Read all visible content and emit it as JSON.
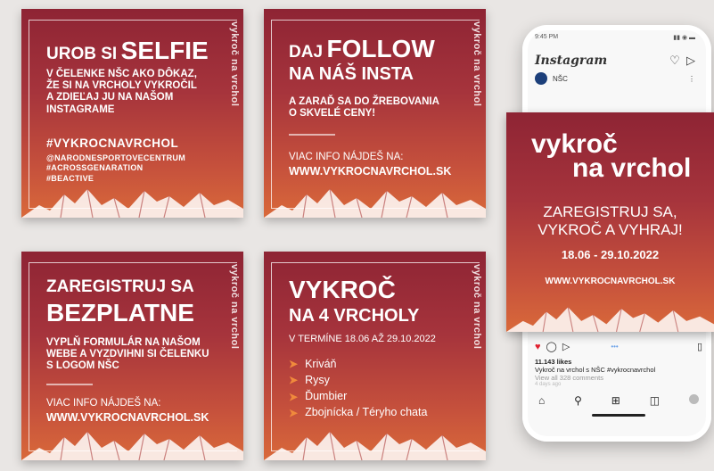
{
  "card1": {
    "logo": "vykroč na vrchol",
    "title_a": "UROB SI",
    "title_b": "SELFIE",
    "body": [
      "V ČELENKE NŠC AKO DÔKAZ,",
      "ŽE SI NA VRCHOLY VYKROČIL",
      "A ZDIEĽAJ JU NA NAŠOM",
      "INSTAGRAME"
    ],
    "hashtag": "#VYKROCNAVRCHOL",
    "tags": [
      "@NARODNESPORTOVECENTRUM",
      "#ACROSSGENARATION",
      "#BEACTIVE"
    ]
  },
  "card2": {
    "logo": "vykroč na vrchol",
    "title_a": "DAJ",
    "title_b": "FOLLOW",
    "title_c": "NA NÁŠ INSTA",
    "body": [
      "A ZARAĎ SA DO ŽREBOVANIA",
      "O SKVELÉ CENY!"
    ],
    "info": "VIAC INFO NÁJDEŠ NA:",
    "url": "WWW.VYKROCNAVRCHOL.SK"
  },
  "card3": {
    "logo": "vykroč na vrchol",
    "title_a": "ZAREGISTRUJ SA",
    "title_b": "BEZPLATNE",
    "body": [
      "VYPLŇ FORMULÁR NA NAŠOM",
      "WEBE A VYZDVIHNI SI ČELENKU",
      "S LOGOM NŠC"
    ],
    "info": "VIAC INFO NÁJDEŠ NA:",
    "url": "WWW.VYKROCNAVRCHOL.SK"
  },
  "card4": {
    "logo": "vykroč na vrchol",
    "title_a": "VYKROČ",
    "title_b": "NA 4 VRCHOLY",
    "dates": "V TERMÍNE 18.06 AŽ 29.10.2022",
    "peaks": [
      "Kriváň",
      "Rysy",
      "Ďumbier",
      "Zbojnícka / Téryho chata"
    ]
  },
  "phone": {
    "time": "9:45 PM",
    "app": "Instagram",
    "account": "NŠC",
    "post": {
      "logo_a": "vykroč",
      "logo_b": "na vrchol",
      "line1": "ZAREGISTRUJ SA,",
      "line2": "VYKROČ A VYHRAJ!",
      "dates": "18.06 - 29.10.2022",
      "url": "WWW.VYKROCNAVRCHOL.SK"
    },
    "likes": "11.143 likes",
    "caption": "Vykroč na vrchol s NŠC #vykrocnavrchol",
    "comments": "View all 328 comments",
    "ago": "4 days ago"
  },
  "colors": {
    "accent": "#f08a3c",
    "like": "#e0202e"
  }
}
